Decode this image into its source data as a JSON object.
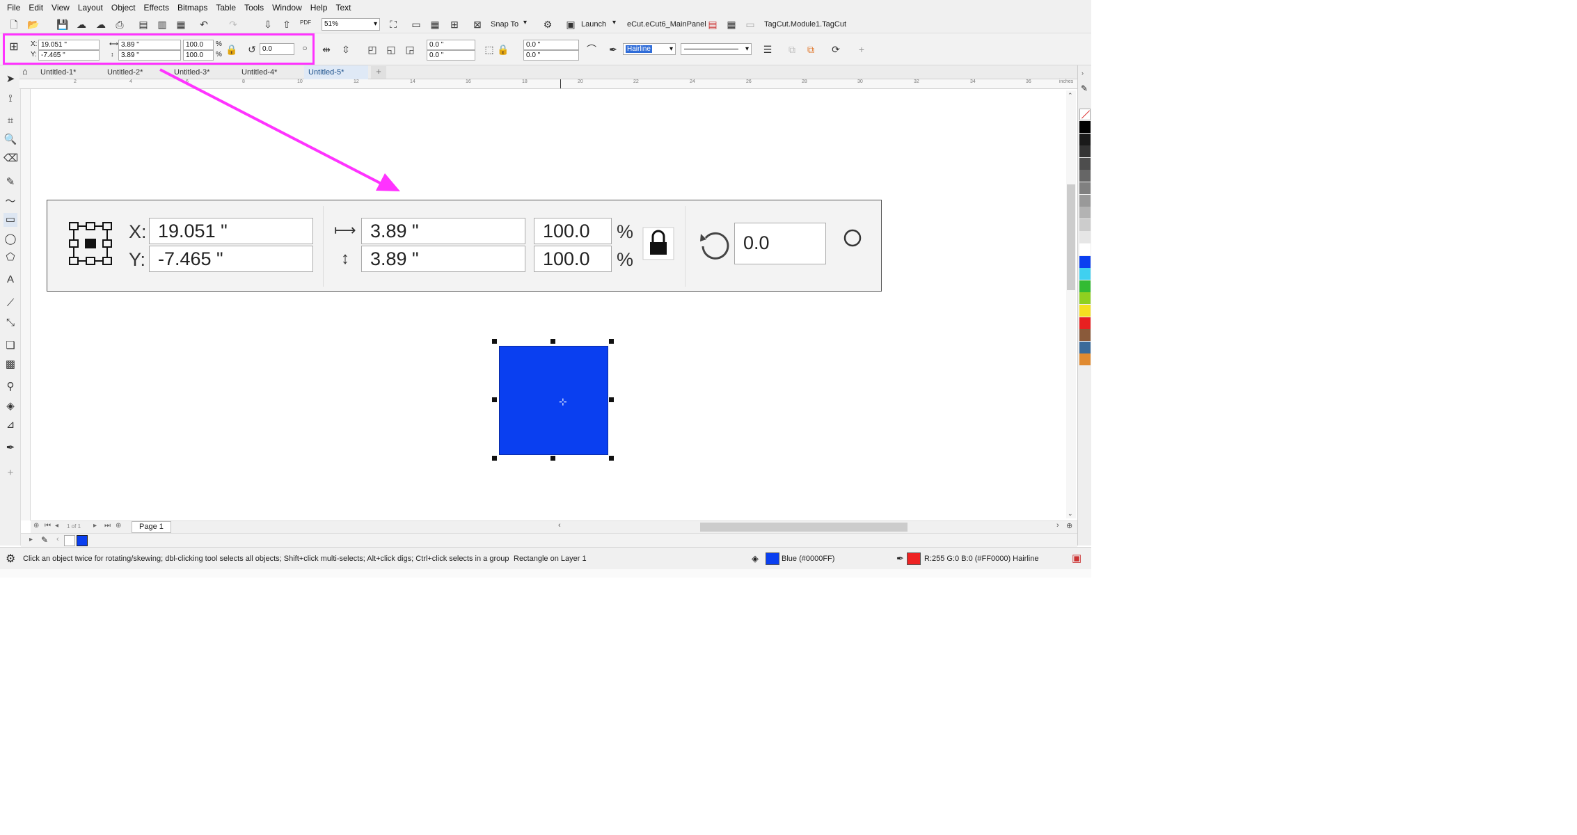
{
  "menu": [
    "File",
    "Edit",
    "View",
    "Layout",
    "Object",
    "Effects",
    "Bitmaps",
    "Table",
    "Tools",
    "Window",
    "Help",
    "Text"
  ],
  "standard_toolbar": {
    "zoom_value": "51%",
    "snap_label": "Snap To",
    "launch_label": "Launch",
    "panel_label": "eCut.eCut6_MainPanel",
    "module_label": "TagCut.Module1.TagCut",
    "pdf_label": "PDF"
  },
  "property_bar": {
    "x_label": "X:",
    "y_label": "Y:",
    "x_value": "19.051 \"",
    "y_value": "-7.465 \"",
    "width_value": "3.89 \"",
    "height_value": "3.89 \"",
    "scale_w": "100.0",
    "scale_h": "100.0",
    "percent": "%",
    "rotation": "0.0",
    "corner_1": "0.0 \"",
    "corner_2": "0.0 \"",
    "corner_3": "0.0 \"",
    "corner_4": "0.0 \"",
    "outline_width": "Hairline"
  },
  "doc_tabs": [
    "Untitled-1*",
    "Untitled-2*",
    "Untitled-3*",
    "Untitled-4*",
    "Untitled-5*"
  ],
  "ruler": {
    "ticks": [
      "2",
      "4",
      "6",
      "8",
      "10",
      "12",
      "14",
      "16",
      "18",
      "20",
      "22",
      "24",
      "26",
      "28",
      "30",
      "32",
      "34",
      "36"
    ],
    "units": "inches"
  },
  "zoom_callout": {
    "x_label": "X:",
    "y_label": "Y:",
    "x_value": "19.051 \"",
    "y_value": "-7.465 \"",
    "width_value": "3.89 \"",
    "height_value": "3.89 \"",
    "scale_w": "100.0",
    "scale_h": "100.0",
    "percent": "%",
    "rotation": "0.0"
  },
  "page_nav": {
    "page_count_text": "1 of 1",
    "page_tab": "Page 1"
  },
  "status": {
    "hint": "Click an object twice for rotating/skewing; dbl-clicking tool selects all objects; Shift+click multi-selects; Alt+click digs; Ctrl+click selects in a group",
    "selection": "Rectangle on Layer 1",
    "fill_label": "Blue (#0000FF)",
    "outline_label": "R:255 G:0 B:0 (#FF0000)  Hairline"
  },
  "colors": {
    "accent_highlight": "#ff33ff",
    "rectangle_fill": "#0a3ff0",
    "fill_swatch": "#0a3ff0",
    "outline_swatch": "#ee2222"
  },
  "palette": [
    "#000000",
    "#1a1a1a",
    "#333333",
    "#4d4d4d",
    "#666666",
    "#808080",
    "#999999",
    "#b3b3b3",
    "#cccccc",
    "#e6e6e6",
    "#ffffff",
    "#0a3ff0",
    "#3fd0f0",
    "#33bb33",
    "#8fd020",
    "#f5e020",
    "#e82020",
    "#8a5a3a",
    "#3a6a9a",
    "#e08a30"
  ]
}
